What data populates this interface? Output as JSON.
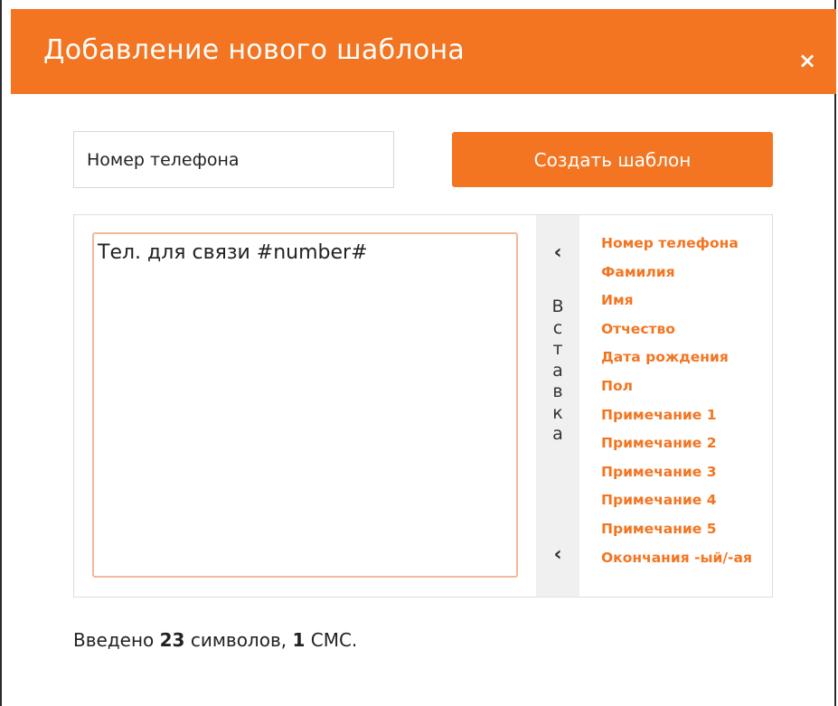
{
  "dialog": {
    "title": "Добавление нового шаблона",
    "close_label": "×"
  },
  "form": {
    "name_value": "Номер телефона",
    "create_button_label": "Создать шаблон",
    "template_text": "Тел. для связи #number#"
  },
  "insert_panel": {
    "chevron_top": "‹",
    "chevron_bottom": "‹",
    "letters": [
      "В",
      "с",
      "т",
      "а",
      "в",
      "к",
      "а"
    ],
    "variables": [
      "Номер телефона",
      "Фамилия",
      "Имя",
      "Отчество",
      "Дата рождения",
      "Пол",
      "Примечание 1",
      "Примечание 2",
      "Примечание 3",
      "Примечание 4",
      "Примечание 5",
      "Окончания -ый/-ая"
    ]
  },
  "status": {
    "prefix": "Введено",
    "chars": "23",
    "chars_word": "символов,",
    "sms": "1",
    "sms_word": "СМС."
  },
  "colors": {
    "accent": "#f47521",
    "textarea_border": "#f3b89a",
    "insert_bg": "#f0f0f0"
  }
}
